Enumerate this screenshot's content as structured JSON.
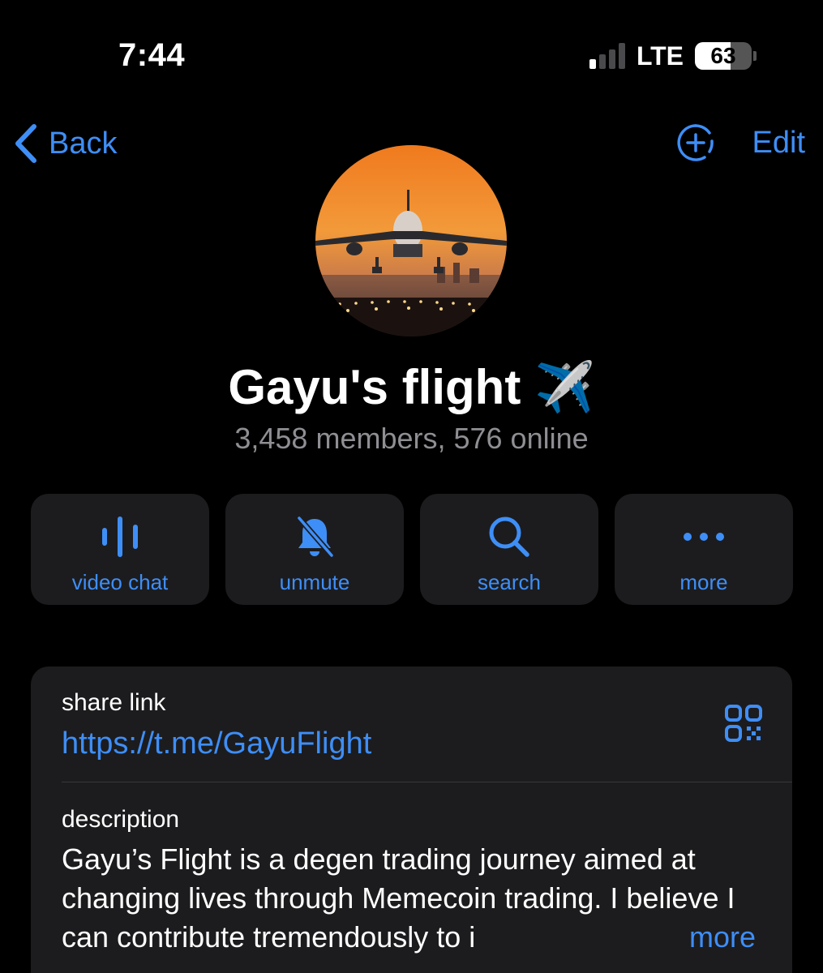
{
  "status_bar": {
    "time": "7:44",
    "network": "LTE",
    "battery": "63"
  },
  "nav": {
    "back_label": "Back",
    "edit_label": "Edit"
  },
  "group": {
    "name": "Gayu's flight ✈️",
    "members_line": "3,458 members, 576 online"
  },
  "actions": [
    {
      "label": "video chat",
      "icon": "voice-chat-icon"
    },
    {
      "label": "unmute",
      "icon": "muted-bell-icon"
    },
    {
      "label": "search",
      "icon": "search-icon"
    },
    {
      "label": "more",
      "icon": "ellipsis-icon"
    }
  ],
  "info": {
    "share_label": "share link",
    "share_url": "https://t.me/GayuFlight",
    "description_label": "description",
    "description": "Gayu’s Flight is a degen trading journey aimed at changing lives through Memecoin trading. I believe I can contribute tremendously to i",
    "more_label": "more"
  },
  "colors": {
    "accent": "#3e8ef7",
    "background": "#000000",
    "card": "#1c1c1e",
    "secondary_text": "#8e8e93"
  }
}
